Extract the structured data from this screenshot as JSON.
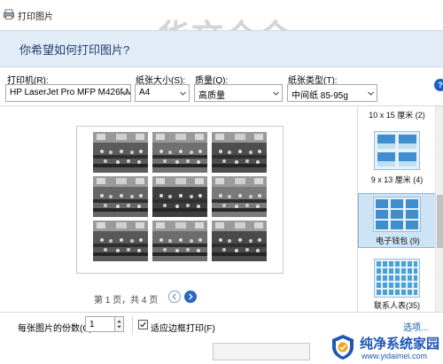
{
  "window": {
    "title": "打印图片",
    "watermark": "华文众合"
  },
  "prompt": "你希望如何打印图片?",
  "options": {
    "printer": {
      "label": "打印机(R):",
      "value": "HP LaserJet Pro MFP M426f-M"
    },
    "paper_size": {
      "label": "纸张大小(S):",
      "value": "A4"
    },
    "quality": {
      "label": "质量(Q):",
      "value": "高质量"
    },
    "paper_type": {
      "label": "纸张类型(T):",
      "value": "中间纸 85-95g"
    },
    "help_icon": "?"
  },
  "preview": {
    "page_info": "第 1 页，共 4 页",
    "prev_icon": "prev-arrow-icon",
    "next_icon": "next-arrow-icon",
    "grid_rows": 3,
    "grid_cols": 3
  },
  "layouts": [
    {
      "label": "10 x 15 厘米 (2)",
      "selected": false
    },
    {
      "label": "9 x 13 厘米 (4)",
      "selected": false
    },
    {
      "label": "电子钱包 (9)",
      "selected": true
    },
    {
      "label": "联系人表(35)",
      "selected": false
    }
  ],
  "bottom": {
    "copies_label": "每张图片的份数(C):",
    "copies_value": "1",
    "fit_label": "适应边框打印(F)",
    "fit_checked": true,
    "options_link": "选项..."
  },
  "brand": {
    "name": "纯净系统家园",
    "url": "www.yidaimei.com"
  },
  "colors": {
    "accent": "#2b66c1",
    "prompt_band": "#e2ecf7",
    "selection": "#cde4f7"
  }
}
